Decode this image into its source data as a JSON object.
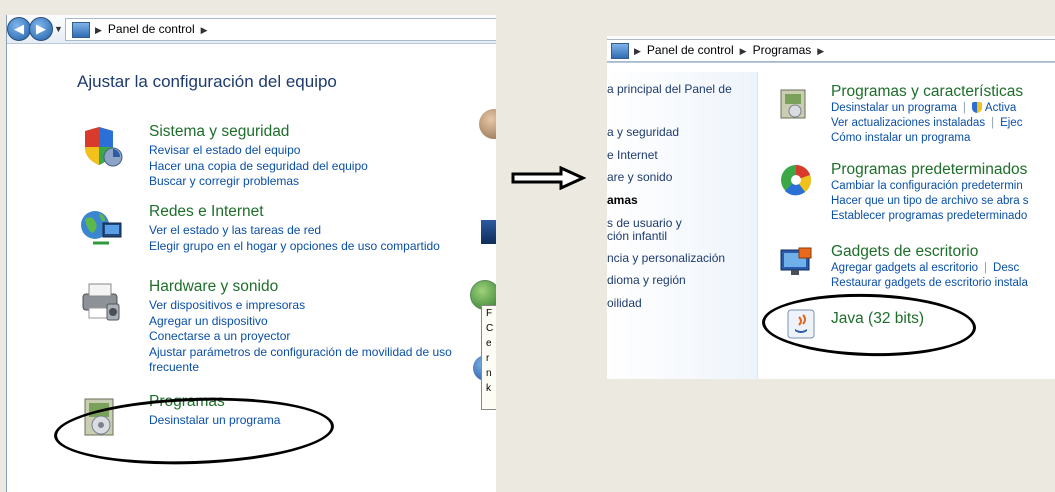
{
  "left_window": {
    "breadcrumb": [
      "Panel de control"
    ],
    "heading": "Ajustar la configuración del equipo",
    "categories": [
      {
        "title": "Sistema y seguridad",
        "icon": "shield-icon",
        "links": [
          "Revisar el estado del equipo",
          "Hacer una copia de seguridad del equipo",
          "Buscar y corregir problemas"
        ]
      },
      {
        "title": "Redes e Internet",
        "icon": "network-icon",
        "links": [
          "Ver el estado y las tareas de red",
          "Elegir grupo en el hogar y opciones de uso compartido"
        ]
      },
      {
        "title": "Hardware y sonido",
        "icon": "printer-icon",
        "links": [
          "Ver dispositivos e impresoras",
          "Agregar un dispositivo",
          "Conectarse a un proyector",
          "Ajustar parámetros de configuración de movilidad de uso frecuente"
        ]
      },
      {
        "title": "Programas",
        "icon": "programs-icon",
        "links": [
          "Desinstalar un programa"
        ]
      }
    ],
    "peek_letters": [
      "F",
      "C",
      "e",
      "r",
      "n",
      "k"
    ]
  },
  "right_window": {
    "breadcrumb": [
      "Panel de control",
      "Programas"
    ],
    "nav": [
      "a principal del Panel de",
      "a y seguridad",
      "e Internet",
      "are y sonido",
      "amas",
      "s de usuario y",
      "ción infantil",
      "ncia y personalización",
      "dioma y región",
      "oilidad"
    ],
    "categories": [
      {
        "title": "Programas y características",
        "icon": "programs-features-icon",
        "link_rows": [
          [
            "Desinstalar un programa",
            "Activa"
          ],
          [
            "Ver actualizaciones instaladas",
            "Ejec"
          ],
          [
            "Cómo instalar un programa"
          ]
        ]
      },
      {
        "title": "Programas predeterminados",
        "icon": "default-programs-icon",
        "link_rows": [
          [
            "Cambiar la configuración predetermin"
          ],
          [
            "Hacer que un tipo de archivo se abra s"
          ],
          [
            "Establecer programas predeterminado"
          ]
        ]
      },
      {
        "title": "Gadgets de escritorio",
        "icon": "gadgets-icon",
        "link_rows": [
          [
            "Agregar gadgets al escritorio",
            "Desc"
          ],
          [
            "Restaurar gadgets de escritorio instala"
          ]
        ]
      },
      {
        "title": "Java (32 bits)",
        "icon": "java-icon",
        "link_rows": []
      }
    ]
  },
  "colors": {
    "category_title": "#1e6e2a",
    "link": "#0a4fa8",
    "heading": "#1e3b6e",
    "background": "#ece9e1"
  }
}
